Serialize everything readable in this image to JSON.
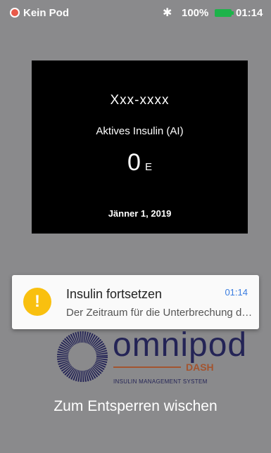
{
  "status_bar": {
    "pod_status": "Kein Pod",
    "battery_percent": "100%",
    "time": "01:14",
    "colors": {
      "pod_icon": "#e85a4a",
      "battery": "#1db34a"
    }
  },
  "info_card": {
    "name": "Xxx-xxxx",
    "label": "Aktives Insulin (AI)",
    "value": "0",
    "unit": "E",
    "date": "Jänner 1, 2019"
  },
  "notification": {
    "icon": "exclamation-icon",
    "title": "Insulin fortsetzen",
    "time": "01:14",
    "text": "Der Zeitraum für die Unterbrechung des Insulins ist abgelaufen."
  },
  "logo": {
    "name": "omnipod",
    "product": "DASH",
    "subtitle": "INSULIN MANAGEMENT SYSTEM"
  },
  "unlock_hint": "Zum Entsperren wischen"
}
